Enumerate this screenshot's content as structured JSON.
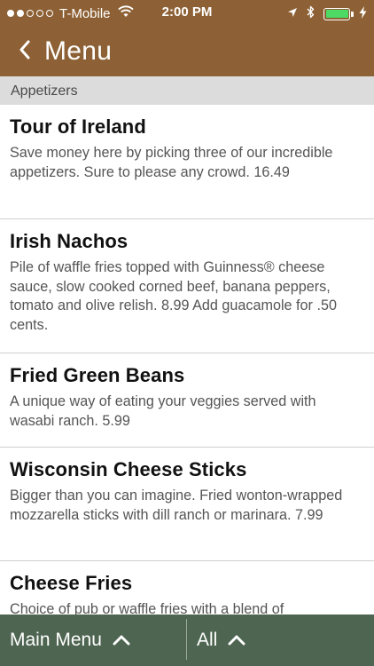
{
  "status_bar": {
    "carrier": "T-Mobile",
    "time": "2:00 PM",
    "signal_filled": 2,
    "signal_total": 5,
    "battery_level": 1.0,
    "icons": [
      "wifi-icon",
      "location-arrow-icon",
      "bluetooth-icon",
      "battery-icon",
      "charging-bolt-icon"
    ]
  },
  "nav": {
    "back_label": "Menu"
  },
  "section": {
    "title": "Appetizers"
  },
  "items": [
    {
      "name": "Tour of Ireland",
      "description": "Save money here by picking three of our incredible appetizers. Sure to please any crowd. 16.49"
    },
    {
      "name": "Irish Nachos",
      "description": "Pile of waffle fries topped with Guinness® cheese sauce, slow cooked corned beef, banana peppers, tomato and olive relish. 8.99 Add guacamole for .50 cents."
    },
    {
      "name": "Fried Green Beans",
      "description": "A unique way of eating your veggies served with wasabi ranch. 5.99"
    },
    {
      "name": "Wisconsin Cheese Sticks",
      "description": "Bigger than you can imagine. Fried wonton-wrapped mozzarella sticks with dill ranch or marinara. 7.99"
    },
    {
      "name": "Cheese Fries",
      "description": "Choice of pub or waffle fries with a blend of"
    }
  ],
  "bottom_bar": {
    "main_menu_label": "Main Menu",
    "all_label": "All"
  },
  "colors": {
    "header_brown": "#8d6135",
    "section_gray": "#dcdcdc",
    "bottom_green": "#4e6551",
    "battery_green": "#4cd964"
  }
}
